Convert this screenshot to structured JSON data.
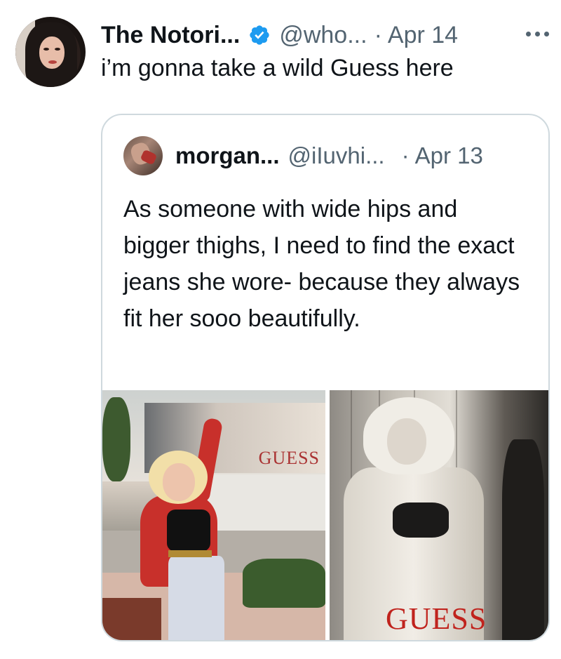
{
  "tweet": {
    "display_name": "The Notori...",
    "handle": "@who...",
    "date": "Apr 14",
    "text": "i’m gonna take a wild Guess here",
    "verified": true,
    "verified_icon": "verified-badge-icon",
    "more_icon": "more-dots-icon",
    "accent_color": "#1d9bf0"
  },
  "quote": {
    "display_name": "morgan...",
    "handle": "@iIuvhi...",
    "date": "Apr 13",
    "text": "As someone with wide hips and bigger thighs, I need to find the exact jeans she wore- because they always fit her sooo beautifully.",
    "media": {
      "left_billboard_text": "GUESS",
      "right_logo_text": "GUESS"
    }
  }
}
